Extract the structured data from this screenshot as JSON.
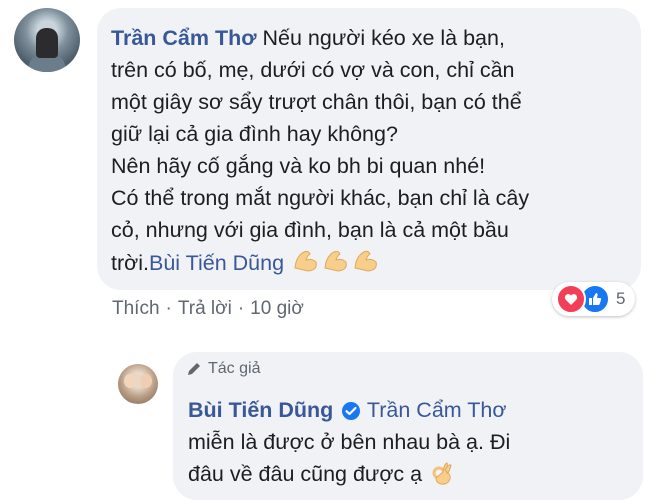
{
  "comment": {
    "author": "Trần Cẩm Thơ",
    "lines": [
      "Nếu người kéo xe là bạn,",
      "trên có bố, mẹ, dưới có vợ và con, chỉ cần",
      "một giây sơ sẩy trượt chân thôi, bạn có thể",
      "giữ lại cả gia đình hay không?",
      "Nên hãy cố gắng và ko bh bi quan nhé!",
      "Có thể trong mắt người khác, bạn chỉ là cây",
      "cỏ, nhưng với gia đình, bạn là cả một bầu",
      "trời."
    ],
    "mention": "Bùi Tiến Dũng",
    "emoji": "flexed-biceps-icon",
    "actions": {
      "like": "Thích",
      "reply": "Trả lời",
      "time": "10 giờ",
      "separator": "·"
    },
    "reactions": {
      "count": "5",
      "types": [
        "heart-icon",
        "like-icon"
      ]
    }
  },
  "reply": {
    "badge": "Tác giả",
    "author": "Bùi Tiến Dũng",
    "mention": "Trần Cẩm Thơ",
    "line1": "miễn là được ở bên nhau bà ạ. Đi",
    "line2": "đâu về đâu cũng được ạ",
    "emoji": "ok-hand-icon"
  },
  "colors": {
    "link": "#385898",
    "bubble": "#f0f2f5",
    "meta": "#606770",
    "heart": "#f33e58",
    "like": "#1877f2",
    "verified": "#1877f2"
  }
}
